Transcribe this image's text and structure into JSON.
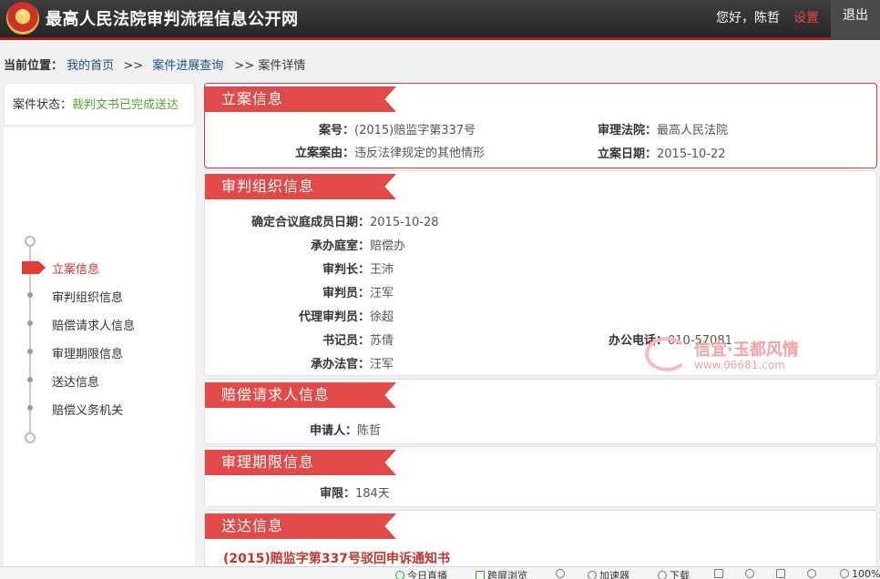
{
  "header": {
    "site_title": "最高人民法院审判流程信息公开网",
    "greeting": "您好，陈哲",
    "settings": "设置",
    "logout": "退出"
  },
  "breadcrumb": {
    "label": "当前位置：",
    "home": "我的首页",
    "sep": ">>",
    "query": "案件进展查询",
    "current": ">> 案件详情"
  },
  "status": {
    "label": "案件状态：",
    "value": "裁判文书已完成送达"
  },
  "nav": {
    "items": [
      {
        "label": "立案信息"
      },
      {
        "label": "审判组织信息"
      },
      {
        "label": "赔偿请求人信息"
      },
      {
        "label": "审理期限信息"
      },
      {
        "label": "送达信息"
      },
      {
        "label": "赔偿义务机关"
      }
    ]
  },
  "filing": {
    "title": "立案信息",
    "case_no_label": "案号：",
    "case_no": "(2015)赔监字第337号",
    "court_label": "审理法院：",
    "court": "最高人民法院",
    "cause_label": "立案案由：",
    "cause": "违反法律规定的其他情形",
    "date_label": "立案日期：",
    "date": "2015-10-22"
  },
  "organization": {
    "title": "审判组织信息",
    "panel_date_label": "确定合议庭成员日期：",
    "panel_date": "2015-10-28",
    "tribunal_label": "承办庭室：",
    "tribunal": "赔偿办",
    "chief_judge_label": "审判长：",
    "chief_judge": "王沛",
    "judge_label": "审判员：",
    "judge": "汪军",
    "acting_judge_label": "代理审判员：",
    "acting_judge": "徐超",
    "clerk_label": "书记员：",
    "clerk": "苏倩",
    "phone_label": "办公电话：",
    "phone": "010-57081",
    "handling_judge_label": "承办法官：",
    "handling_judge": "汪军"
  },
  "claimant": {
    "title": "赔偿请求人信息",
    "applicant_label": "申请人：",
    "applicant": "陈哲"
  },
  "term": {
    "title": "审理期限信息",
    "limit_label": "审限：",
    "limit": "184天"
  },
  "service": {
    "title": "送达信息",
    "doc_title": "(2015)赔监字第337号驳回申诉通知书"
  },
  "watermark": {
    "text": "信宜·玉都风情",
    "url": "www.06681.com"
  },
  "statusbar": {
    "live": "今日直播",
    "reader": "跨屏浏览",
    "accelerator": "加速器",
    "download": "下载",
    "zoom": "100%"
  }
}
